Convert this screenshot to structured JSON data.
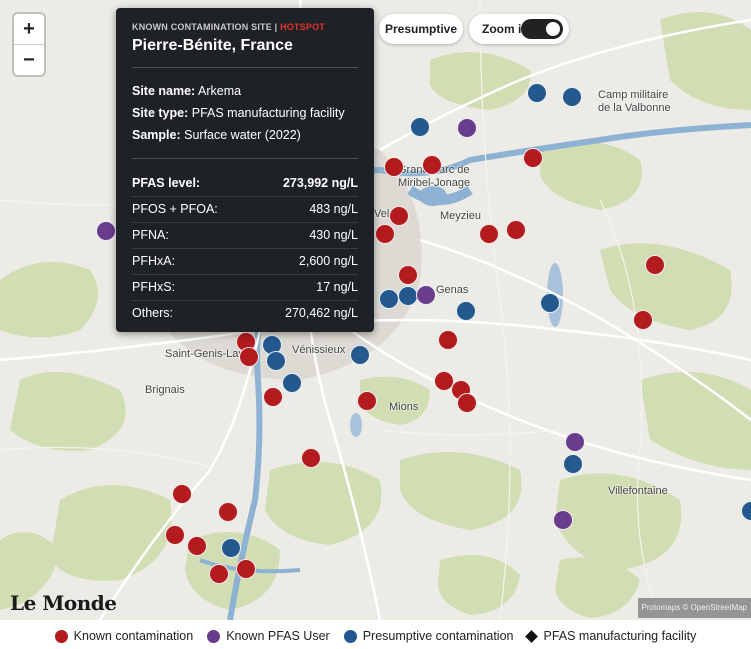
{
  "zoom": {
    "plus": "+",
    "minus": "−"
  },
  "filters": {
    "presumptive_label": "Presumptive",
    "zoom_in_label": "Zoom in",
    "zoom_in_enabled": true
  },
  "tooltip": {
    "category": "KNOWN CONTAMINATION SITE | ",
    "hotspot": "HOTSPOT",
    "title": "Pierre-Bénite, France",
    "site_name_label": "Site name:",
    "site_name": "Arkema",
    "site_type_label": "Site type:",
    "site_type": "PFAS manufacturing facility",
    "sample_label": "Sample:",
    "sample": "Surface water (2022)",
    "levels": [
      {
        "name": "PFAS level:",
        "value": "273,992 ng/L"
      },
      {
        "name": "PFOS + PFOA:",
        "value": "483 ng/L"
      },
      {
        "name": "PFNA:",
        "value": "430 ng/L"
      },
      {
        "name": "PFHxA:",
        "value": "2,600 ng/L"
      },
      {
        "name": "PFHxS:",
        "value": "17 ng/L"
      },
      {
        "name": "Others:",
        "value": "270,462 ng/L"
      }
    ]
  },
  "places": {
    "camp": "Camp militaire\nde la Valbonne",
    "grand_parc": "Grand Parc de\nMiribel-Jonage",
    "meyzieu": "Meyzieu",
    "genas": "Genas",
    "saint_genis": "Saint-Genis-Laval",
    "venissieux": "Vénissieux",
    "brignais": "Brignais",
    "mions": "Mions",
    "villefontaine": "Villefontaine",
    "velin": "Vel"
  },
  "brand": "Le Monde",
  "attribution": "Protomaps © OpenStreetMap",
  "colors": {
    "known": "#b31b1e",
    "user": "#6a3d8c",
    "presumptive": "#23598f"
  },
  "legend": [
    {
      "label": "Known contamination",
      "kind": "known"
    },
    {
      "label": "Known PFAS User",
      "kind": "user"
    },
    {
      "label": "Presumptive contamination",
      "kind": "presumptive"
    },
    {
      "label": "PFAS manufacturing facility",
      "kind": "facility"
    }
  ]
}
